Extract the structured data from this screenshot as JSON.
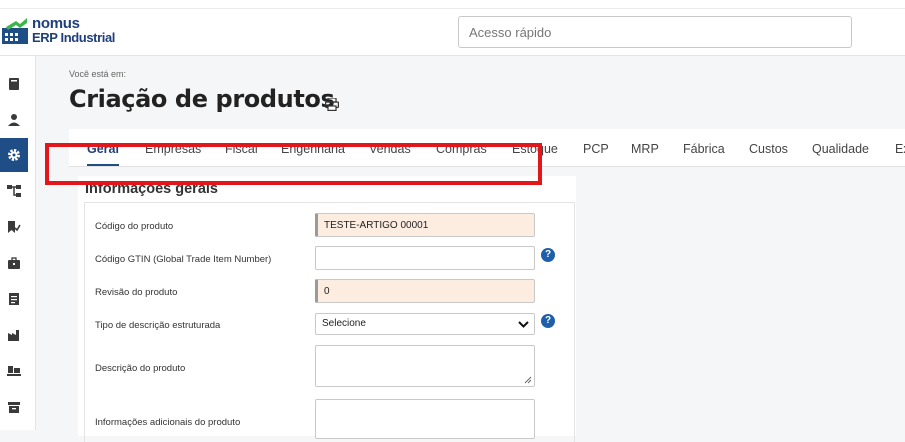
{
  "app": {
    "brand_line1": "nomus",
    "brand_line2": "ERP Industrial",
    "quick_access_placeholder": "Acesso rápido"
  },
  "sidebar": {
    "items": [
      {
        "icon": "book-icon"
      },
      {
        "icon": "user-icon"
      },
      {
        "icon": "gear-icon",
        "active": true
      },
      {
        "icon": "hierarchy-icon"
      },
      {
        "icon": "bookmark-check-icon"
      },
      {
        "icon": "briefcase-icon"
      },
      {
        "icon": "document-icon"
      },
      {
        "icon": "factory-icon"
      },
      {
        "icon": "pallet-icon"
      },
      {
        "icon": "archive-icon"
      }
    ],
    "accent": "#1f4e86"
  },
  "page": {
    "breadcrumb": "Você está em:",
    "title": "Criação de produtos"
  },
  "tabs": [
    {
      "label": "Geral",
      "active": true
    },
    {
      "label": "Empresas"
    },
    {
      "label": "Fiscal"
    },
    {
      "label": "Engenharia"
    },
    {
      "label": "Vendas"
    },
    {
      "label": "Compras"
    },
    {
      "label": "Estoque"
    },
    {
      "label": "PCP"
    },
    {
      "label": "MRP"
    },
    {
      "label": "Fábrica"
    },
    {
      "label": "Custos"
    },
    {
      "label": "Qualidade"
    },
    {
      "label": "Ex"
    }
  ],
  "form": {
    "section_title": "Informações gerais",
    "fields": {
      "codigo": {
        "label": "Código do produto",
        "value": "TESTE-ARTIGO 00001"
      },
      "gtin": {
        "label": "Código GTIN (Global Trade Item Number)",
        "value": ""
      },
      "revisao": {
        "label": "Revisão do produto",
        "value": "0"
      },
      "tipo_descricao": {
        "label": "Tipo de descrição estruturada",
        "value": "Selecione"
      },
      "descricao": {
        "label": "Descrição do produto",
        "value": ""
      },
      "info_adicionais": {
        "label": "Informações adicionais do produto",
        "value": ""
      }
    },
    "help_glyph": "?"
  },
  "colors": {
    "brand": "#1f3f7a",
    "required_field_bg": "#fdece0",
    "highlight": "#e3161b",
    "help": "#1f5ea8"
  }
}
